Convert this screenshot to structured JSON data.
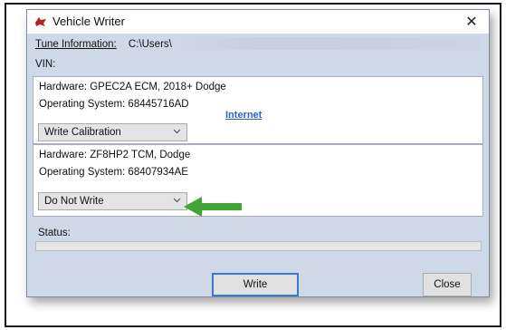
{
  "window": {
    "title": "Vehicle Writer",
    "close_glyph": "✕",
    "icon": "vehicle-writer-app-icon"
  },
  "info": {
    "tune_label": "Tune Information:",
    "tune_value": "C:\\Users\\",
    "vin_label": "VIN:"
  },
  "modules": [
    {
      "hardware": "Hardware: GPEC2A ECM, 2018+ Dodge",
      "os": "Operating System: 68445716AD",
      "link": "Internet",
      "action": "Write Calibration"
    },
    {
      "hardware": "Hardware: ZF8HP2 TCM, Dodge",
      "os": "Operating System: 68407934AE",
      "action": "Do Not Write"
    }
  ],
  "status": {
    "label": "Status:",
    "progress": 0
  },
  "buttons": {
    "write": "Write",
    "close": "Close"
  },
  "colors": {
    "window_bg": "#cfd8e6",
    "link": "#2b63c7",
    "arrow": "#3fa535",
    "write_button_border": "#3a78d2"
  },
  "annotation": {
    "icon": "green-arrow-icon"
  }
}
